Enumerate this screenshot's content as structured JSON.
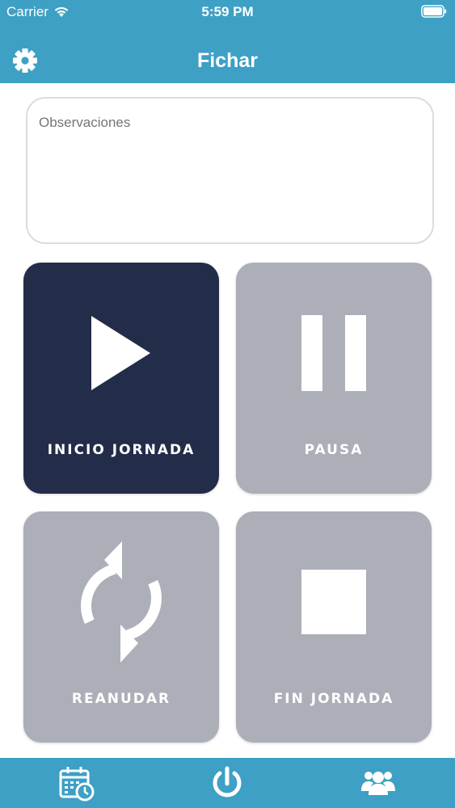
{
  "status_bar": {
    "carrier": "Carrier",
    "time": "5:59 PM",
    "wifi_icon": "wifi-icon",
    "battery_icon": "battery-icon"
  },
  "nav": {
    "title": "Fichar",
    "settings_icon": "gear-icon"
  },
  "observations": {
    "placeholder": "Observaciones",
    "value": ""
  },
  "actions": [
    {
      "label": "INICIO JORNADA",
      "icon": "play-icon",
      "active": true
    },
    {
      "label": "PAUSA",
      "icon": "pause-icon",
      "active": false
    },
    {
      "label": "REANUDAR",
      "icon": "refresh-icon",
      "active": false
    },
    {
      "label": "FIN JORNADA",
      "icon": "stop-icon",
      "active": false
    }
  ],
  "tabbar": {
    "items": [
      {
        "icon": "calendar-clock-icon"
      },
      {
        "icon": "power-icon",
        "selected": true
      },
      {
        "icon": "users-icon"
      }
    ]
  },
  "colors": {
    "header": "#3da0c4",
    "active_tile": "#232c48",
    "inactive_tile": "#acaeb8",
    "white": "#ffffff"
  }
}
